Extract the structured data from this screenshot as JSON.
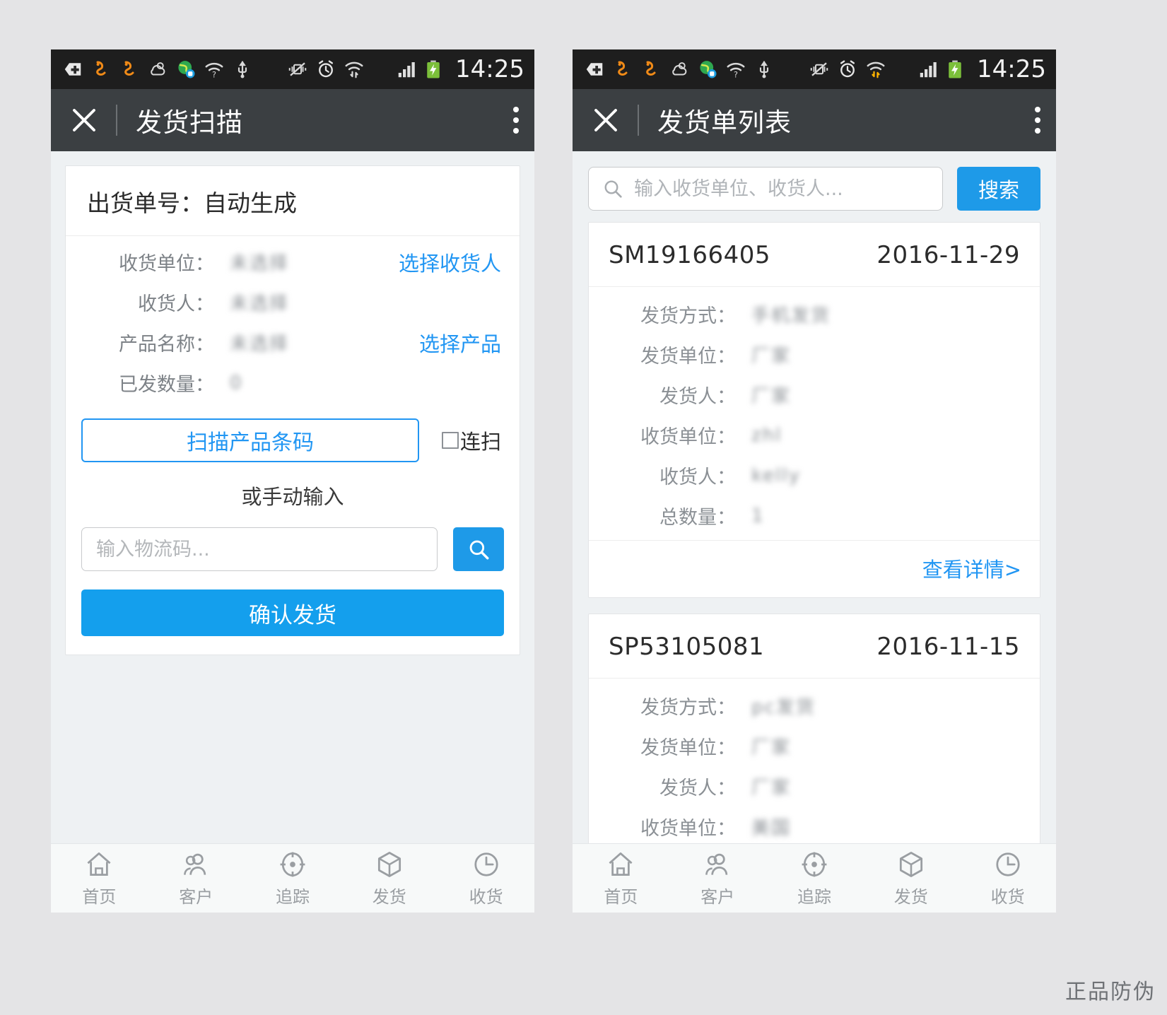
{
  "status_bar": {
    "time": "14:25",
    "icons": [
      "plus-badge-icon",
      "uc-browser-icon",
      "uc-browser-icon",
      "weather-cloud-icon",
      "app-globe-icon",
      "wifi-question-icon",
      "usb-icon",
      "vibrate-off-icon",
      "alarm-icon",
      "wifi-sync-icon",
      "signal-bars-icon",
      "battery-charging-icon"
    ]
  },
  "left_screen": {
    "title": "发货扫描",
    "close_icon": "close-icon",
    "menu_icon": "overflow-menu-icon",
    "form": {
      "header": "出货单号：自动生成",
      "rows": [
        {
          "label": "收货单位：",
          "value": "未选择",
          "action": "选择收货人",
          "has_action": true
        },
        {
          "label": "收货人：",
          "value": "未选择",
          "action": "",
          "has_action": false
        },
        {
          "label": "产品名称：",
          "value": "未选择",
          "action": "选择产品",
          "has_action": true
        },
        {
          "label": "已发数量：",
          "value": "0",
          "action": "",
          "has_action": false
        }
      ],
      "scan_button": "扫描产品条码",
      "continuous_checkbox": "连扫",
      "or_manual": "或手动输入",
      "code_placeholder": "输入物流码...",
      "code_value": "",
      "search_icon": "search-icon",
      "confirm_button": "确认发货"
    }
  },
  "right_screen": {
    "title": "发货单列表",
    "close_icon": "close-icon",
    "menu_icon": "overflow-menu-icon",
    "search": {
      "placeholder": "输入收货单位、收货人...",
      "value": "",
      "icon": "search-icon",
      "button": "搜索"
    },
    "cards": [
      {
        "number": "SM19166405",
        "date": "2016-11-29",
        "rows": [
          {
            "label": "发货方式：",
            "value": "手机发货"
          },
          {
            "label": "发货单位：",
            "value": "厂家"
          },
          {
            "label": "发货人：",
            "value": "厂家"
          },
          {
            "label": "收货单位：",
            "value": "zhl"
          },
          {
            "label": "收货人：",
            "value": "kelly"
          },
          {
            "label": "总数量：",
            "value": "1"
          }
        ],
        "detail_link": "查看详情>"
      },
      {
        "number": "SP53105081",
        "date": "2016-11-15",
        "rows": [
          {
            "label": "发货方式：",
            "value": "pc发货"
          },
          {
            "label": "发货单位：",
            "value": "厂家"
          },
          {
            "label": "发货人：",
            "value": "厂家"
          },
          {
            "label": "收货单位：",
            "value": "美国"
          }
        ],
        "detail_link": ""
      }
    ]
  },
  "tabbar": {
    "items": [
      {
        "label": "首页",
        "icon": "home-icon"
      },
      {
        "label": "客户",
        "icon": "users-icon"
      },
      {
        "label": "追踪",
        "icon": "target-icon"
      },
      {
        "label": "发货",
        "icon": "box-icon"
      },
      {
        "label": "收货",
        "icon": "clock-icon"
      }
    ]
  },
  "watermark": "正品防伪",
  "colors": {
    "accent": "#1e9ae8",
    "link": "#2196f3",
    "statusbar": "#1e1e1e",
    "titlebar": "#3b3f42",
    "page_bg": "#e4e4e6",
    "screen_bg": "#eef1f3"
  }
}
